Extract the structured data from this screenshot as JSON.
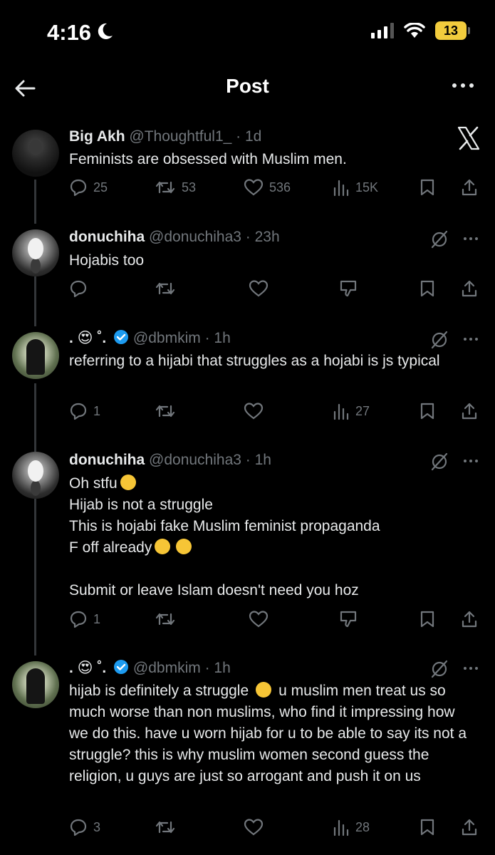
{
  "status_bar": {
    "time": "4:16",
    "battery": "13"
  },
  "nav": {
    "title": "Post"
  },
  "tweets": [
    {
      "name": "Big Akh",
      "handle": "@Thoughtful1_",
      "time": "· 1d",
      "text": "Feminists are obsessed with Muslim men.",
      "replies": "25",
      "retweets": "53",
      "likes": "536",
      "views": "15K"
    },
    {
      "name": "donuchiha",
      "handle": "@donuchiha3",
      "time": "· 23h",
      "text": "Hojabis too"
    },
    {
      "name": ". 😍 ˚.",
      "handle": "@dbmkim",
      "time": "· 1h",
      "text": "referring to a hijabi that struggles as a hojabi is js typical",
      "replies": "1",
      "views": "27"
    },
    {
      "name": "donuchiha",
      "handle": "@donuchiha3",
      "time": "· 1h",
      "line1": "Oh stfu",
      "line2": "Hijab is not a struggle",
      "line3": "This is hojabi fake Muslim feminist propaganda",
      "line4": "F off already",
      "line5": "Submit or leave Islam doesn't need you hoz",
      "replies": "1"
    },
    {
      "name": ". 😍 ˚.",
      "handle": "@dbmkim",
      "time": "· 1h",
      "text_a": "hijab is definitely a struggle",
      "text_b": "u muslim men treat us so much worse than non muslims, who find it impressing how we do this. have u worn hijab for u to be able to say its not a struggle? this is why muslim women second guess the religion, u guys are just so arrogant and push it on us",
      "replies": "3",
      "views": "28"
    }
  ]
}
